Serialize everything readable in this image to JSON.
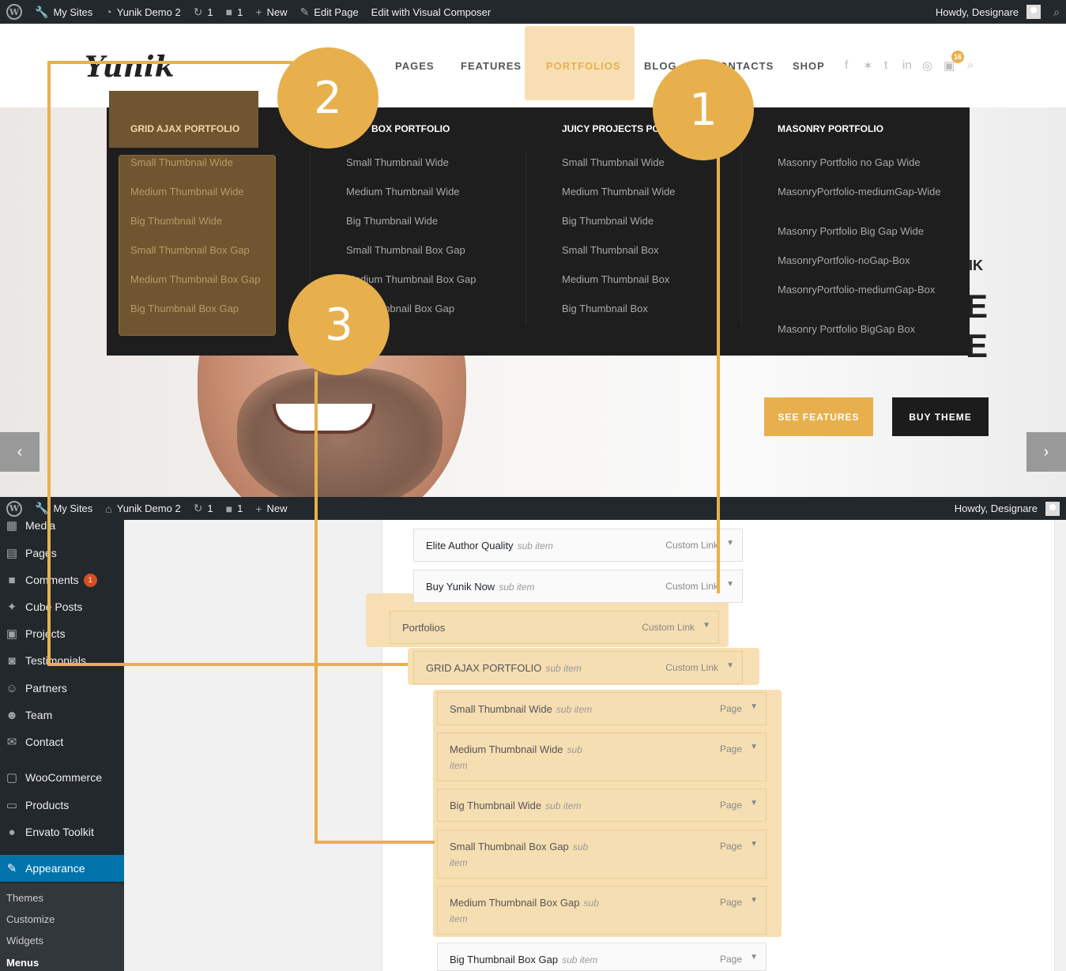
{
  "topbar": {
    "my_sites": "My Sites",
    "site": "Yunik Demo 2",
    "updates": "1",
    "comments": "1",
    "new": "New",
    "edit_page": "Edit Page",
    "visual_composer": "Edit with Visual Composer",
    "howdy": "Howdy, Designare"
  },
  "header": {
    "logo": "Yunik",
    "nav": [
      "PAGES",
      "FEATURES",
      "PORTFOLIOS",
      "BLOG",
      "CONTACTS",
      "SHOP"
    ],
    "cart_count": "16"
  },
  "mega": {
    "columns": [
      {
        "title": "GRID AJAX PORTFOLIO",
        "items": [
          "Small Thumbnail Wide",
          "Medium Thumbnail Wide",
          "Big Thumbnail Wide",
          "Small Thumbnail Box Gap",
          "Medium Thumbnail Box Gap",
          "Big Thumbnail Box Gap"
        ]
      },
      {
        "title": "BOX PORTFOLIO",
        "items": [
          "Small Thumbnail Wide",
          "Medium Thumbnail Wide",
          "Big Thumbnail Wide",
          "Small Thumbnail Box Gap",
          "Medium Thumbnail Box Gap",
          "Big Thumbnail Box Gap"
        ]
      },
      {
        "title": "JUICY PROJECTS POR",
        "items": [
          "Small Thumbnail Wide",
          "Medium Thumbnail Wide",
          "Big Thumbnail Wide",
          "Small Thumbnail Box",
          "Medium Thumbnail Box",
          "Big Thumbnail Box"
        ]
      },
      {
        "title": "MASONRY PORTFOLIO",
        "items": [
          "Masonry Portfolio no Gap Wide",
          "MasonryPortfolio-mediumGap-Wide",
          "Masonry Portfolio Big Gap Wide",
          "MasonryPortfolio-noGap-Box",
          "MasonryPortfolio-mediumGap-Box",
          "Masonry Portfolio BigGap Box"
        ]
      }
    ]
  },
  "hero": {
    "btn_features": "SEE FEATURES",
    "btn_buy": "BUY THEME"
  },
  "bottombar": {
    "my_sites": "My Sites",
    "site": "Yunik Demo 2",
    "updates": "1",
    "comments": "1",
    "new": "New",
    "howdy": "Howdy, Designare"
  },
  "sidebar": {
    "items": [
      "Media",
      "Pages",
      "Comments",
      "Cube Posts",
      "Projects",
      "Testimonials",
      "Partners",
      "Team",
      "Contact",
      "WooCommerce",
      "Products",
      "Envato Toolkit",
      "Appearance"
    ],
    "comments_badge": "1",
    "sub": [
      "Themes",
      "Customize",
      "Widgets",
      "Menus"
    ]
  },
  "menu_items": [
    {
      "title": "Elite Author Quality",
      "sub": "sub item",
      "type": "Custom Link"
    },
    {
      "title": "Buy Yunik Now",
      "sub": "sub item",
      "type": "Custom Link"
    },
    {
      "title": "Portfolios",
      "sub": "",
      "type": "Custom Link"
    },
    {
      "title": "GRID AJAX PORTFOLIO",
      "sub": "sub item",
      "type": "Custom Link"
    },
    {
      "title": "Small Thumbnail Wide",
      "sub": "sub item",
      "type": "Page"
    },
    {
      "title": "Medium Thumbnail Wide",
      "sub": "sub",
      "sub2": "item",
      "type": "Page"
    },
    {
      "title": "Big Thumbnail Wide",
      "sub": "sub item",
      "type": "Page"
    },
    {
      "title": "Small Thumbnail Box Gap",
      "sub": "sub",
      "sub2": "item",
      "type": "Page"
    },
    {
      "title": "Medium Thumbnail Box Gap",
      "sub": "sub",
      "sub2": "item",
      "type": "Page"
    },
    {
      "title": "Big Thumbnail Box Gap",
      "sub": "sub item",
      "type": "Page"
    }
  ],
  "annotations": [
    "1",
    "2",
    "3"
  ],
  "colors": {
    "accent": "#e8b04c",
    "highlight": "#f7dfb3",
    "admin_dark": "#23282d",
    "admin_blue": "#0073aa"
  }
}
